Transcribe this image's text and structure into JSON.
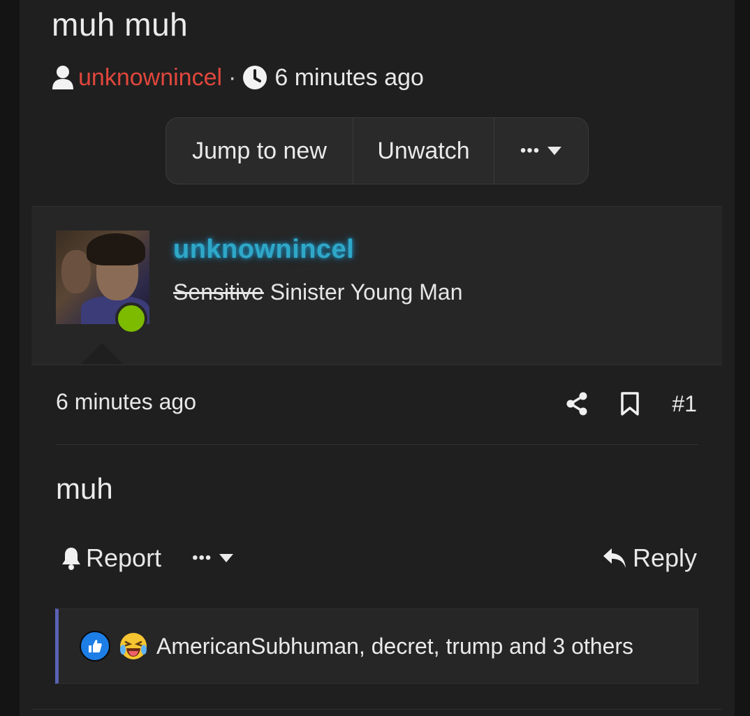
{
  "thread": {
    "title": "muh muh",
    "author": "unknownincel",
    "separator": "·",
    "time": "6 minutes ago"
  },
  "actions": {
    "jump_label": "Jump to new",
    "unwatch_label": "Unwatch",
    "more_label": "•••"
  },
  "post": {
    "username": "unknownincel",
    "user_title_struck": "Sensitive",
    "user_title_rest": " Sinister Young Man",
    "time": "6 minutes ago",
    "number": "#1",
    "body": "muh",
    "report_label": "Report",
    "more_label": "•••",
    "reply_label": "Reply",
    "reactions_text": "AmericanSubhuman, decret, trump and 3 others"
  },
  "colors": {
    "author_red": "#e0473c",
    "username_cyan": "#2fa8c8",
    "online_green": "#7cbb00",
    "reaction_accent": "#5a62b5"
  },
  "icons": [
    "user-icon",
    "clock-icon",
    "caret-down-icon",
    "share-icon",
    "bookmark-icon",
    "bell-icon",
    "reply-arrow-icon",
    "like-reaction-icon",
    "laugh-reaction-icon"
  ]
}
